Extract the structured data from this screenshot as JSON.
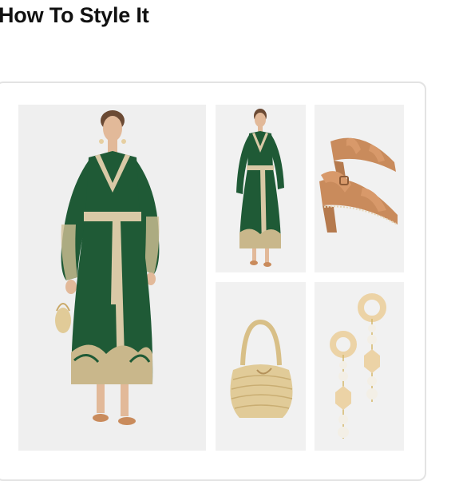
{
  "section": {
    "title": "How To Style It"
  },
  "products": [
    {
      "name": "green-embroidered-wrap-dress",
      "icon": "model-wearing-dress-image"
    },
    {
      "name": "green-embroidered-wrap-dress-thumbnail",
      "icon": "dress-product-image"
    },
    {
      "name": "tan-leather-heeled-sandals",
      "icon": "sandals-image"
    },
    {
      "name": "woven-straw-handbag",
      "icon": "straw-bag-image"
    },
    {
      "name": "wood-and-pearl-drop-earrings",
      "icon": "earrings-image"
    }
  ],
  "colors": {
    "dress_green": "#1f5a36",
    "trim_beige": "#d9c9a6",
    "leather_tan": "#c98b5c",
    "straw": "#e1cb98",
    "wood": "#ecd3a6",
    "pearl": "#f3efe6",
    "background": "#f1f1f1"
  }
}
